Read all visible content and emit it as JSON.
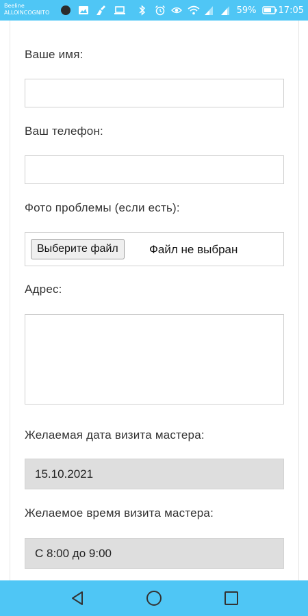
{
  "status_bar": {
    "carrier_line1": "Beeline",
    "carrier_line2": "ALLOINCOGNITO",
    "left_icons": [
      "circle-icon",
      "image-icon",
      "broom-icon",
      "laptop-icon"
    ],
    "right_icons": [
      "bluetooth-icon",
      "alarm-icon",
      "eye-icon",
      "wifi-icon",
      "signal-icon",
      "signal-icon",
      "battery-icon"
    ],
    "battery": "59%",
    "time": "17:05",
    "color": "#4fc6f5"
  },
  "form": {
    "name_label": "Ваше имя:",
    "name_value": "",
    "phone_label": "Ваш телефон:",
    "phone_value": "",
    "photo_label": "Фото проблемы (если есть):",
    "file_button": "Выберите файл",
    "file_status": "Файл не выбран",
    "address_label": "Адрес:",
    "address_value": "",
    "date_label": "Желаемая дата визита мастера:",
    "date_value": "15.10.2021",
    "time_label": "Желаемое время визита мастера:",
    "time_value": "С 8:00 до 9:00"
  },
  "nav_bar": {
    "buttons": [
      "back-icon",
      "home-icon",
      "recents-icon"
    ],
    "color": "#4fc6f5"
  }
}
